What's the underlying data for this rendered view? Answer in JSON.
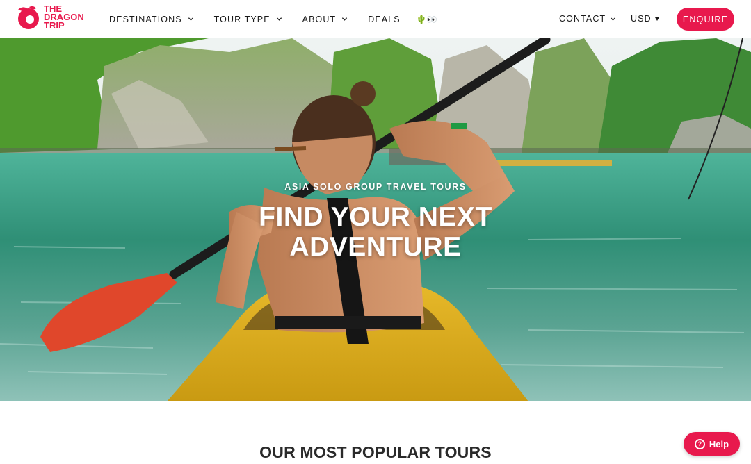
{
  "brand": {
    "name_line1": "THE",
    "name_line2": "DRAGON",
    "name_line3": "TRIP",
    "color": "#e8194d",
    "logo_icon": "dragon-swirl-logo"
  },
  "nav": {
    "items": [
      {
        "label": "DESTINATIONS",
        "has_dropdown": true
      },
      {
        "label": "TOUR TYPE",
        "has_dropdown": true
      },
      {
        "label": "ABOUT",
        "has_dropdown": true
      },
      {
        "label": "DEALS",
        "has_dropdown": false
      }
    ],
    "emoji": "🌵👀",
    "contact_label": "CONTACT",
    "currency_label": "USD",
    "enquire_label": "ENQUIRE"
  },
  "hero": {
    "eyebrow": "ASIA SOLO GROUP TRAVEL TOURS",
    "title_line1": "FIND YOUR NEXT",
    "title_line2": "ADVENTURE",
    "image": "woman-kayaking-ha-long-bay"
  },
  "popular": {
    "title": "OUR MOST POPULAR TOURS"
  },
  "help": {
    "label": "Help",
    "icon": "question-icon"
  }
}
